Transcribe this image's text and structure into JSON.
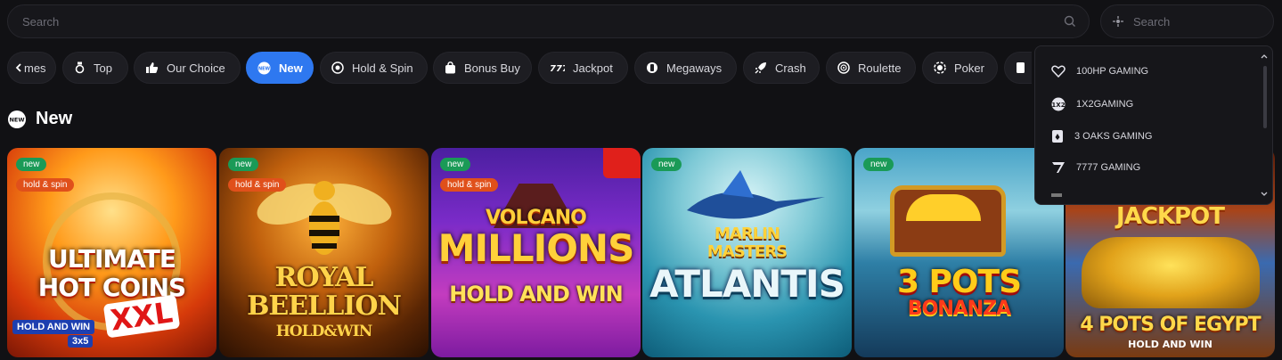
{
  "search": {
    "placeholder": "Search"
  },
  "provider_search": {
    "placeholder": "Search"
  },
  "categories": [
    {
      "label": "mes",
      "icon": "list-icon"
    },
    {
      "label": "Top",
      "icon": "medal-icon"
    },
    {
      "label": "Our Choice",
      "icon": "thumbs-up-icon"
    },
    {
      "label": "New",
      "icon": "new-badge-icon",
      "active": true
    },
    {
      "label": "Hold & Spin",
      "icon": "coin-icon"
    },
    {
      "label": "Bonus Buy",
      "icon": "bag-icon"
    },
    {
      "label": "Jackpot",
      "icon": "777-icon"
    },
    {
      "label": "Megaways",
      "icon": "megaways-icon"
    },
    {
      "label": "Crash",
      "icon": "rocket-icon"
    },
    {
      "label": "Roulette",
      "icon": "roulette-icon"
    },
    {
      "label": "Poker",
      "icon": "chip-icon"
    }
  ],
  "section": {
    "title": "New"
  },
  "games": [
    {
      "title_line1": "ULTIMATE",
      "title_line2": "HOT COINS",
      "sub1": "HOLD AND WIN",
      "sub2": "XXL",
      "sub3": "3x5",
      "badges": [
        "new",
        "hold & spin"
      ]
    },
    {
      "title_line1": "ROYAL",
      "title_line2": "BEELLION",
      "sub1": "HOLD&WIN",
      "badges": [
        "new",
        "hold & spin"
      ]
    },
    {
      "title_line1": "VOLCANO",
      "title_line2": "MILLIONS",
      "sub1": "HOLD AND WIN",
      "badges": [
        "new",
        "hold & spin"
      ]
    },
    {
      "title_line1": "MARLIN",
      "title_line2": "MASTERS",
      "sub1": "ATLANTIS",
      "badges": [
        "new"
      ]
    },
    {
      "title_line1": "3 POTS",
      "title_line2": "BONANZA",
      "badges": [
        "new"
      ]
    },
    {
      "title_line1": "JACKPOT",
      "title_line2": "4 POTS OF EGYPT",
      "sub1": "HOLD AND WIN",
      "badges": []
    }
  ],
  "providers": [
    {
      "name": "100HP GAMING",
      "icon": "heart-icon"
    },
    {
      "name": "1X2GAMING",
      "icon": "1x2-icon"
    },
    {
      "name": "3 OAKS GAMING",
      "icon": "card-icon"
    },
    {
      "name": "7777 GAMING",
      "icon": "seven-icon"
    }
  ]
}
